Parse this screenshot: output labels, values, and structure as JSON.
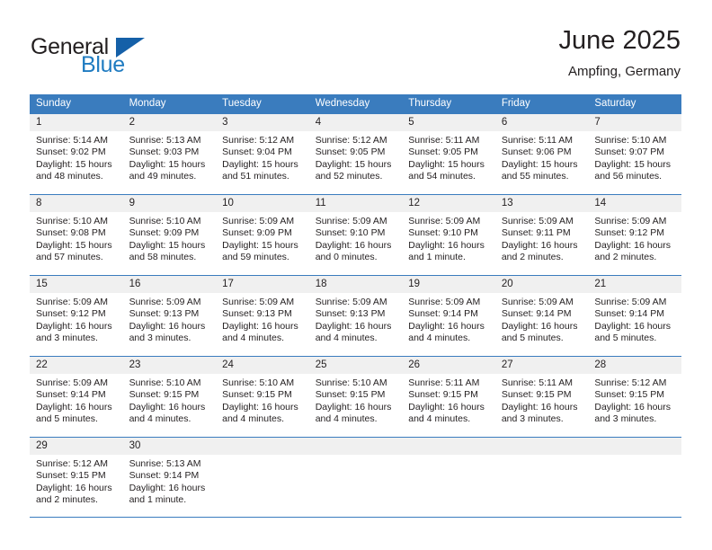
{
  "brand": {
    "line1": "General",
    "line2": "Blue",
    "triangle_color": "#1560a8",
    "blue_text_color": "#1f7bc1"
  },
  "header": {
    "title": "June 2025",
    "subtitle": "Ampfing, Germany",
    "accent_color": "#3a7cbe",
    "daynum_background": "#f0f0f0"
  },
  "weekday_headers": [
    "Sunday",
    "Monday",
    "Tuesday",
    "Wednesday",
    "Thursday",
    "Friday",
    "Saturday"
  ],
  "weeks": [
    [
      {
        "day": "1",
        "sunrise": "Sunrise: 5:14 AM",
        "sunset": "Sunset: 9:02 PM",
        "daylight_1": "Daylight: 15 hours",
        "daylight_2": "and 48 minutes."
      },
      {
        "day": "2",
        "sunrise": "Sunrise: 5:13 AM",
        "sunset": "Sunset: 9:03 PM",
        "daylight_1": "Daylight: 15 hours",
        "daylight_2": "and 49 minutes."
      },
      {
        "day": "3",
        "sunrise": "Sunrise: 5:12 AM",
        "sunset": "Sunset: 9:04 PM",
        "daylight_1": "Daylight: 15 hours",
        "daylight_2": "and 51 minutes."
      },
      {
        "day": "4",
        "sunrise": "Sunrise: 5:12 AM",
        "sunset": "Sunset: 9:05 PM",
        "daylight_1": "Daylight: 15 hours",
        "daylight_2": "and 52 minutes."
      },
      {
        "day": "5",
        "sunrise": "Sunrise: 5:11 AM",
        "sunset": "Sunset: 9:05 PM",
        "daylight_1": "Daylight: 15 hours",
        "daylight_2": "and 54 minutes."
      },
      {
        "day": "6",
        "sunrise": "Sunrise: 5:11 AM",
        "sunset": "Sunset: 9:06 PM",
        "daylight_1": "Daylight: 15 hours",
        "daylight_2": "and 55 minutes."
      },
      {
        "day": "7",
        "sunrise": "Sunrise: 5:10 AM",
        "sunset": "Sunset: 9:07 PM",
        "daylight_1": "Daylight: 15 hours",
        "daylight_2": "and 56 minutes."
      }
    ],
    [
      {
        "day": "8",
        "sunrise": "Sunrise: 5:10 AM",
        "sunset": "Sunset: 9:08 PM",
        "daylight_1": "Daylight: 15 hours",
        "daylight_2": "and 57 minutes."
      },
      {
        "day": "9",
        "sunrise": "Sunrise: 5:10 AM",
        "sunset": "Sunset: 9:09 PM",
        "daylight_1": "Daylight: 15 hours",
        "daylight_2": "and 58 minutes."
      },
      {
        "day": "10",
        "sunrise": "Sunrise: 5:09 AM",
        "sunset": "Sunset: 9:09 PM",
        "daylight_1": "Daylight: 15 hours",
        "daylight_2": "and 59 minutes."
      },
      {
        "day": "11",
        "sunrise": "Sunrise: 5:09 AM",
        "sunset": "Sunset: 9:10 PM",
        "daylight_1": "Daylight: 16 hours",
        "daylight_2": "and 0 minutes."
      },
      {
        "day": "12",
        "sunrise": "Sunrise: 5:09 AM",
        "sunset": "Sunset: 9:10 PM",
        "daylight_1": "Daylight: 16 hours",
        "daylight_2": "and 1 minute."
      },
      {
        "day": "13",
        "sunrise": "Sunrise: 5:09 AM",
        "sunset": "Sunset: 9:11 PM",
        "daylight_1": "Daylight: 16 hours",
        "daylight_2": "and 2 minutes."
      },
      {
        "day": "14",
        "sunrise": "Sunrise: 5:09 AM",
        "sunset": "Sunset: 9:12 PM",
        "daylight_1": "Daylight: 16 hours",
        "daylight_2": "and 2 minutes."
      }
    ],
    [
      {
        "day": "15",
        "sunrise": "Sunrise: 5:09 AM",
        "sunset": "Sunset: 9:12 PM",
        "daylight_1": "Daylight: 16 hours",
        "daylight_2": "and 3 minutes."
      },
      {
        "day": "16",
        "sunrise": "Sunrise: 5:09 AM",
        "sunset": "Sunset: 9:13 PM",
        "daylight_1": "Daylight: 16 hours",
        "daylight_2": "and 3 minutes."
      },
      {
        "day": "17",
        "sunrise": "Sunrise: 5:09 AM",
        "sunset": "Sunset: 9:13 PM",
        "daylight_1": "Daylight: 16 hours",
        "daylight_2": "and 4 minutes."
      },
      {
        "day": "18",
        "sunrise": "Sunrise: 5:09 AM",
        "sunset": "Sunset: 9:13 PM",
        "daylight_1": "Daylight: 16 hours",
        "daylight_2": "and 4 minutes."
      },
      {
        "day": "19",
        "sunrise": "Sunrise: 5:09 AM",
        "sunset": "Sunset: 9:14 PM",
        "daylight_1": "Daylight: 16 hours",
        "daylight_2": "and 4 minutes."
      },
      {
        "day": "20",
        "sunrise": "Sunrise: 5:09 AM",
        "sunset": "Sunset: 9:14 PM",
        "daylight_1": "Daylight: 16 hours",
        "daylight_2": "and 5 minutes."
      },
      {
        "day": "21",
        "sunrise": "Sunrise: 5:09 AM",
        "sunset": "Sunset: 9:14 PM",
        "daylight_1": "Daylight: 16 hours",
        "daylight_2": "and 5 minutes."
      }
    ],
    [
      {
        "day": "22",
        "sunrise": "Sunrise: 5:09 AM",
        "sunset": "Sunset: 9:14 PM",
        "daylight_1": "Daylight: 16 hours",
        "daylight_2": "and 5 minutes."
      },
      {
        "day": "23",
        "sunrise": "Sunrise: 5:10 AM",
        "sunset": "Sunset: 9:15 PM",
        "daylight_1": "Daylight: 16 hours",
        "daylight_2": "and 4 minutes."
      },
      {
        "day": "24",
        "sunrise": "Sunrise: 5:10 AM",
        "sunset": "Sunset: 9:15 PM",
        "daylight_1": "Daylight: 16 hours",
        "daylight_2": "and 4 minutes."
      },
      {
        "day": "25",
        "sunrise": "Sunrise: 5:10 AM",
        "sunset": "Sunset: 9:15 PM",
        "daylight_1": "Daylight: 16 hours",
        "daylight_2": "and 4 minutes."
      },
      {
        "day": "26",
        "sunrise": "Sunrise: 5:11 AM",
        "sunset": "Sunset: 9:15 PM",
        "daylight_1": "Daylight: 16 hours",
        "daylight_2": "and 4 minutes."
      },
      {
        "day": "27",
        "sunrise": "Sunrise: 5:11 AM",
        "sunset": "Sunset: 9:15 PM",
        "daylight_1": "Daylight: 16 hours",
        "daylight_2": "and 3 minutes."
      },
      {
        "day": "28",
        "sunrise": "Sunrise: 5:12 AM",
        "sunset": "Sunset: 9:15 PM",
        "daylight_1": "Daylight: 16 hours",
        "daylight_2": "and 3 minutes."
      }
    ],
    [
      {
        "day": "29",
        "sunrise": "Sunrise: 5:12 AM",
        "sunset": "Sunset: 9:15 PM",
        "daylight_1": "Daylight: 16 hours",
        "daylight_2": "and 2 minutes."
      },
      {
        "day": "30",
        "sunrise": "Sunrise: 5:13 AM",
        "sunset": "Sunset: 9:14 PM",
        "daylight_1": "Daylight: 16 hours",
        "daylight_2": "and 1 minute."
      },
      {
        "day": "",
        "sunrise": "",
        "sunset": "",
        "daylight_1": "",
        "daylight_2": ""
      },
      {
        "day": "",
        "sunrise": "",
        "sunset": "",
        "daylight_1": "",
        "daylight_2": ""
      },
      {
        "day": "",
        "sunrise": "",
        "sunset": "",
        "daylight_1": "",
        "daylight_2": ""
      },
      {
        "day": "",
        "sunrise": "",
        "sunset": "",
        "daylight_1": "",
        "daylight_2": ""
      },
      {
        "day": "",
        "sunrise": "",
        "sunset": "",
        "daylight_1": "",
        "daylight_2": ""
      }
    ]
  ]
}
